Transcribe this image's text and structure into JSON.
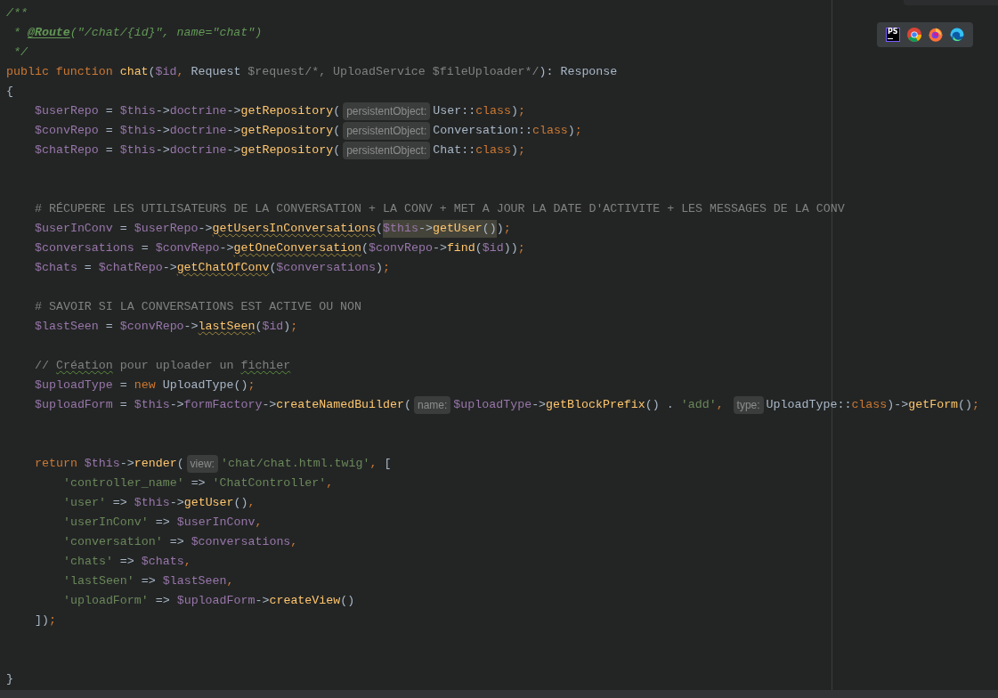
{
  "toolbar": {
    "items": [
      {
        "kind": "phpstorm",
        "text": "PS"
      },
      {
        "kind": "chrome"
      },
      {
        "kind": "firefox"
      },
      {
        "kind": "edge"
      }
    ]
  },
  "lines": [
    {
      "kind": "top",
      "segments": [
        {
          "kind": "doc",
          "text": "/**"
        }
      ]
    },
    {
      "kind": "top",
      "segments": [
        {
          "kind": "doc",
          "text": " * "
        },
        {
          "kind": "doctag",
          "text": "@Route"
        },
        {
          "kind": "doc",
          "text": "(\"/chat/{id}\", name=\"chat\")"
        }
      ]
    },
    {
      "kind": "top",
      "segments": [
        {
          "kind": "doc",
          "text": " */"
        }
      ]
    },
    {
      "kind": "top",
      "segments": [
        {
          "kind": "keyword",
          "text": "public function "
        },
        {
          "kind": "func",
          "text": "chat"
        },
        {
          "kind": "plain",
          "text": "("
        },
        {
          "kind": "var",
          "text": "$id"
        },
        {
          "kind": "keyword",
          "text": ", "
        },
        {
          "kind": "plain",
          "text": "Request "
        },
        {
          "kind": "comment",
          "text": "$request/*, UploadService $fileUploader*/"
        },
        {
          "kind": "plain",
          "text": "): Response"
        }
      ]
    },
    {
      "kind": "top",
      "segments": [
        {
          "kind": "plain",
          "text": "{"
        }
      ]
    },
    {
      "kind": "body",
      "segments": [
        {
          "kind": "var",
          "text": "$userRepo"
        },
        {
          "kind": "plain",
          "text": " = "
        },
        {
          "kind": "var",
          "text": "$this"
        },
        {
          "kind": "plain",
          "text": "->"
        },
        {
          "kind": "var",
          "text": "doctrine"
        },
        {
          "kind": "plain",
          "text": "->"
        },
        {
          "kind": "func",
          "text": "getRepository"
        },
        {
          "kind": "plain",
          "text": "("
        },
        {
          "kind": "hint",
          "text": "persistentObject:"
        },
        {
          "kind": "plain",
          "text": "User::"
        },
        {
          "kind": "keyword",
          "text": "class"
        },
        {
          "kind": "plain",
          "text": ")"
        },
        {
          "kind": "keyword",
          "text": ";"
        }
      ]
    },
    {
      "kind": "body",
      "segments": [
        {
          "kind": "var",
          "text": "$convRepo"
        },
        {
          "kind": "plain",
          "text": " = "
        },
        {
          "kind": "var",
          "text": "$this"
        },
        {
          "kind": "plain",
          "text": "->"
        },
        {
          "kind": "var",
          "text": "doctrine"
        },
        {
          "kind": "plain",
          "text": "->"
        },
        {
          "kind": "func",
          "text": "getRepository"
        },
        {
          "kind": "plain",
          "text": "("
        },
        {
          "kind": "hint",
          "text": "persistentObject:"
        },
        {
          "kind": "plain",
          "text": "Conversation::"
        },
        {
          "kind": "keyword",
          "text": "class"
        },
        {
          "kind": "plain",
          "text": ")"
        },
        {
          "kind": "keyword",
          "text": ";"
        }
      ]
    },
    {
      "kind": "body",
      "segments": [
        {
          "kind": "var",
          "text": "$chatRepo"
        },
        {
          "kind": "plain",
          "text": " = "
        },
        {
          "kind": "var",
          "text": "$this"
        },
        {
          "kind": "plain",
          "text": "->"
        },
        {
          "kind": "var",
          "text": "doctrine"
        },
        {
          "kind": "plain",
          "text": "->"
        },
        {
          "kind": "func",
          "text": "getRepository"
        },
        {
          "kind": "plain",
          "text": "("
        },
        {
          "kind": "hint",
          "text": "persistentObject:"
        },
        {
          "kind": "plain",
          "text": "Chat::"
        },
        {
          "kind": "keyword",
          "text": "class"
        },
        {
          "kind": "plain",
          "text": ")"
        },
        {
          "kind": "keyword",
          "text": ";"
        }
      ]
    },
    {
      "kind": "blank"
    },
    {
      "kind": "blank"
    },
    {
      "kind": "body",
      "segments": [
        {
          "kind": "comment",
          "text": "# RÉCUPERE LES UTILISATEURS DE LA CONVERSATION + LA CONV + MET A JOUR LA DATE D'ACTIVITE + LES MESSAGES DE LA CONV"
        }
      ]
    },
    {
      "kind": "body",
      "segments": [
        {
          "kind": "var",
          "text": "$userInConv"
        },
        {
          "kind": "plain",
          "text": " = "
        },
        {
          "kind": "var",
          "text": "$userRepo"
        },
        {
          "kind": "plain",
          "text": "->"
        },
        {
          "kind": "func-warn",
          "text": "getUsersInConversations"
        },
        {
          "kind": "plain",
          "text": "("
        },
        {
          "kind": "var-hl",
          "text": "$this"
        },
        {
          "kind": "plain-hl",
          "text": "->"
        },
        {
          "kind": "func-hl",
          "text": "getUser"
        },
        {
          "kind": "plain-hl",
          "text": "()"
        },
        {
          "kind": "plain",
          "text": ")"
        },
        {
          "kind": "keyword",
          "text": ";"
        }
      ]
    },
    {
      "kind": "body",
      "segments": [
        {
          "kind": "var",
          "text": "$conversations"
        },
        {
          "kind": "plain",
          "text": " = "
        },
        {
          "kind": "var",
          "text": "$convRepo"
        },
        {
          "kind": "plain",
          "text": "->"
        },
        {
          "kind": "func-warn",
          "text": "getOneConversation"
        },
        {
          "kind": "plain",
          "text": "("
        },
        {
          "kind": "var",
          "text": "$convRepo"
        },
        {
          "kind": "plain",
          "text": "->"
        },
        {
          "kind": "func",
          "text": "find"
        },
        {
          "kind": "plain",
          "text": "("
        },
        {
          "kind": "var",
          "text": "$id"
        },
        {
          "kind": "plain",
          "text": "))"
        },
        {
          "kind": "keyword",
          "text": ";"
        }
      ]
    },
    {
      "kind": "body",
      "segments": [
        {
          "kind": "var",
          "text": "$chats"
        },
        {
          "kind": "plain",
          "text": " = "
        },
        {
          "kind": "var",
          "text": "$chatRepo"
        },
        {
          "kind": "plain",
          "text": "->"
        },
        {
          "kind": "func-warn",
          "text": "getChatOfConv"
        },
        {
          "kind": "plain",
          "text": "("
        },
        {
          "kind": "var",
          "text": "$conversations"
        },
        {
          "kind": "plain",
          "text": ")"
        },
        {
          "kind": "keyword",
          "text": ";"
        }
      ]
    },
    {
      "kind": "blank"
    },
    {
      "kind": "body",
      "segments": [
        {
          "kind": "comment",
          "text": "# SAVOIR SI LA CONVERSATIONS EST ACTIVE OU NON"
        }
      ]
    },
    {
      "kind": "body",
      "segments": [
        {
          "kind": "var",
          "text": "$lastSeen"
        },
        {
          "kind": "plain",
          "text": " = "
        },
        {
          "kind": "var",
          "text": "$convRepo"
        },
        {
          "kind": "plain",
          "text": "->"
        },
        {
          "kind": "func-warn",
          "text": "lastSeen"
        },
        {
          "kind": "plain",
          "text": "("
        },
        {
          "kind": "var",
          "text": "$id"
        },
        {
          "kind": "plain",
          "text": ")"
        },
        {
          "kind": "keyword",
          "text": ";"
        }
      ]
    },
    {
      "kind": "blank"
    },
    {
      "kind": "body",
      "segments": [
        {
          "kind": "comment",
          "text": "// "
        },
        {
          "kind": "typo",
          "text": "Création"
        },
        {
          "kind": "comment",
          "text": " pour uploader un "
        },
        {
          "kind": "typo",
          "text": "fichier"
        }
      ]
    },
    {
      "kind": "body",
      "segments": [
        {
          "kind": "var",
          "text": "$uploadType"
        },
        {
          "kind": "plain",
          "text": " = "
        },
        {
          "kind": "keyword",
          "text": "new "
        },
        {
          "kind": "plain",
          "text": "UploadType()"
        },
        {
          "kind": "keyword",
          "text": ";"
        }
      ]
    },
    {
      "kind": "body",
      "segments": [
        {
          "kind": "var",
          "text": "$uploadForm"
        },
        {
          "kind": "plain",
          "text": " = "
        },
        {
          "kind": "var",
          "text": "$this"
        },
        {
          "kind": "plain",
          "text": "->"
        },
        {
          "kind": "var",
          "text": "formFactory"
        },
        {
          "kind": "plain",
          "text": "->"
        },
        {
          "kind": "func",
          "text": "createNamedBuilder"
        },
        {
          "kind": "plain",
          "text": "("
        },
        {
          "kind": "hint",
          "text": "name:"
        },
        {
          "kind": "var",
          "text": "$uploadType"
        },
        {
          "kind": "plain",
          "text": "->"
        },
        {
          "kind": "func",
          "text": "getBlockPrefix"
        },
        {
          "kind": "plain",
          "text": "() . "
        },
        {
          "kind": "str",
          "text": "'add'"
        },
        {
          "kind": "keyword",
          "text": ", "
        },
        {
          "kind": "hint",
          "text": "type:"
        },
        {
          "kind": "plain",
          "text": "UploadType::"
        },
        {
          "kind": "keyword",
          "text": "class"
        },
        {
          "kind": "plain",
          "text": ")->"
        },
        {
          "kind": "func",
          "text": "getForm"
        },
        {
          "kind": "plain",
          "text": "()"
        },
        {
          "kind": "keyword",
          "text": ";"
        }
      ]
    },
    {
      "kind": "blank"
    },
    {
      "kind": "blank"
    },
    {
      "kind": "body",
      "segments": [
        {
          "kind": "keyword",
          "text": "return "
        },
        {
          "kind": "var",
          "text": "$this"
        },
        {
          "kind": "plain",
          "text": "->"
        },
        {
          "kind": "func",
          "text": "render"
        },
        {
          "kind": "plain",
          "text": "("
        },
        {
          "kind": "hint",
          "text": "view:"
        },
        {
          "kind": "str",
          "text": "'chat/chat.html.twig'"
        },
        {
          "kind": "keyword",
          "text": ", "
        },
        {
          "kind": "plain",
          "text": "["
        }
      ]
    },
    {
      "kind": "nested",
      "segments": [
        {
          "kind": "str",
          "text": "'controller_name'"
        },
        {
          "kind": "plain",
          "text": " => "
        },
        {
          "kind": "str",
          "text": "'ChatController'"
        },
        {
          "kind": "keyword",
          "text": ","
        }
      ]
    },
    {
      "kind": "nested",
      "segments": [
        {
          "kind": "str",
          "text": "'user'"
        },
        {
          "kind": "plain",
          "text": " => "
        },
        {
          "kind": "var",
          "text": "$this"
        },
        {
          "kind": "plain",
          "text": "->"
        },
        {
          "kind": "func",
          "text": "getUser"
        },
        {
          "kind": "plain",
          "text": "()"
        },
        {
          "kind": "keyword",
          "text": ","
        }
      ]
    },
    {
      "kind": "nested",
      "segments": [
        {
          "kind": "str",
          "text": "'userInConv'"
        },
        {
          "kind": "plain",
          "text": " => "
        },
        {
          "kind": "var",
          "text": "$userInConv"
        },
        {
          "kind": "keyword",
          "text": ","
        }
      ]
    },
    {
      "kind": "nested",
      "segments": [
        {
          "kind": "str",
          "text": "'conversation'"
        },
        {
          "kind": "plain",
          "text": " => "
        },
        {
          "kind": "var",
          "text": "$conversations"
        },
        {
          "kind": "keyword",
          "text": ","
        }
      ]
    },
    {
      "kind": "nested",
      "segments": [
        {
          "kind": "str",
          "text": "'chats'"
        },
        {
          "kind": "plain",
          "text": " => "
        },
        {
          "kind": "var",
          "text": "$chats"
        },
        {
          "kind": "keyword",
          "text": ","
        }
      ]
    },
    {
      "kind": "nested",
      "segments": [
        {
          "kind": "str",
          "text": "'lastSeen'"
        },
        {
          "kind": "plain",
          "text": " => "
        },
        {
          "kind": "var",
          "text": "$lastSeen"
        },
        {
          "kind": "keyword",
          "text": ","
        }
      ]
    },
    {
      "kind": "nested",
      "segments": [
        {
          "kind": "str",
          "text": "'uploadForm'"
        },
        {
          "kind": "plain",
          "text": " => "
        },
        {
          "kind": "var",
          "text": "$uploadForm"
        },
        {
          "kind": "plain",
          "text": "->"
        },
        {
          "kind": "func",
          "text": "createView"
        },
        {
          "kind": "plain",
          "text": "()"
        }
      ]
    },
    {
      "kind": "body",
      "segments": [
        {
          "kind": "plain",
          "text": "])"
        },
        {
          "kind": "keyword",
          "text": ";"
        }
      ]
    },
    {
      "kind": "blank"
    },
    {
      "kind": "blank"
    },
    {
      "kind": "top",
      "segments": [
        {
          "kind": "plain",
          "text": "}"
        }
      ]
    }
  ]
}
